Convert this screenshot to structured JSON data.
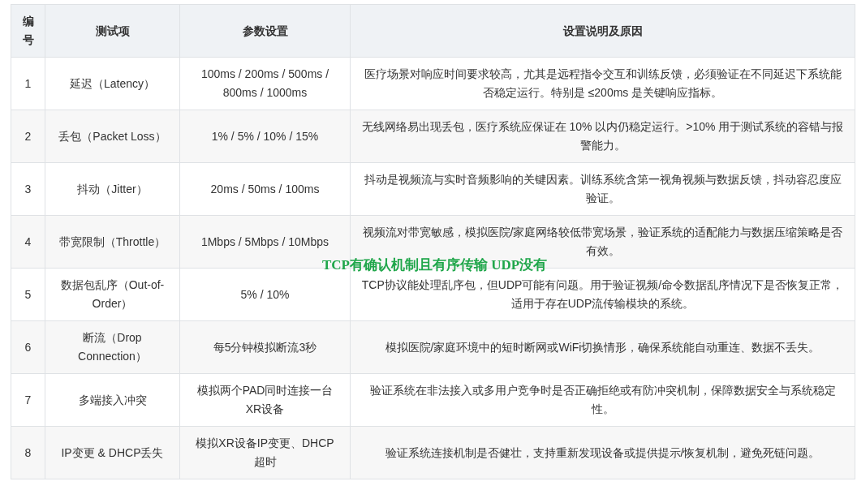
{
  "table": {
    "columns": [
      "编号",
      "测试项",
      "参数设置",
      "设置说明及原因"
    ],
    "rows": [
      [
        "1",
        "延迟（Latency）",
        "100ms / 200ms / 500ms / 800ms / 1000ms",
        "医疗场景对响应时间要求较高，尤其是远程指令交互和训练反馈，必须验证在不同延迟下系统能否稳定运行。特别是 ≤200ms 是关键响应指标。"
      ],
      [
        "2",
        "丢包（Packet Loss）",
        "1% / 5% / 10% / 15%",
        "无线网络易出现丢包，医疗系统应保证在 10% 以内仍稳定运行。>10% 用于测试系统的容错与报警能力。"
      ],
      [
        "3",
        "抖动（Jitter）",
        "20ms / 50ms / 100ms",
        "抖动是视频流与实时音频影响的关键因素。训练系统含第一视角视频与数据反馈，抖动容忍度应验证。"
      ],
      [
        "4",
        "带宽限制（Throttle）",
        "1Mbps / 5Mbps / 10Mbps",
        "视频流对带宽敏感，模拟医院/家庭网络较低带宽场景，验证系统的适配能力与数据压缩策略是否有效。"
      ],
      [
        "5",
        "数据包乱序（Out-of-Order）",
        "5% / 10%",
        "TCP协议能处理乱序包，但UDP可能有问题。用于验证视频/命令数据乱序情况下是否恢复正常，适用于存在UDP流传输模块的系统。"
      ],
      [
        "6",
        "断流（Drop Connection）",
        "每5分钟模拟断流3秒",
        "模拟医院/家庭环境中的短时断网或WiFi切换情形，确保系统能自动重连、数据不丢失。"
      ],
      [
        "7",
        "多端接入冲突",
        "模拟两个PAD同时连接一台XR设备",
        "验证系统在非法接入或多用户竞争时是否正确拒绝或有防冲突机制，保障数据安全与系统稳定性。"
      ],
      [
        "8",
        "IP变更 & DHCP丢失",
        "模拟XR设备IP变更、DHCP超时",
        "验证系统连接机制是否健壮，支持重新发现设备或提供提示/恢复机制，避免死链问题。"
      ]
    ]
  },
  "annotation": "TCP有确认机制且有序传输 UDP没有"
}
